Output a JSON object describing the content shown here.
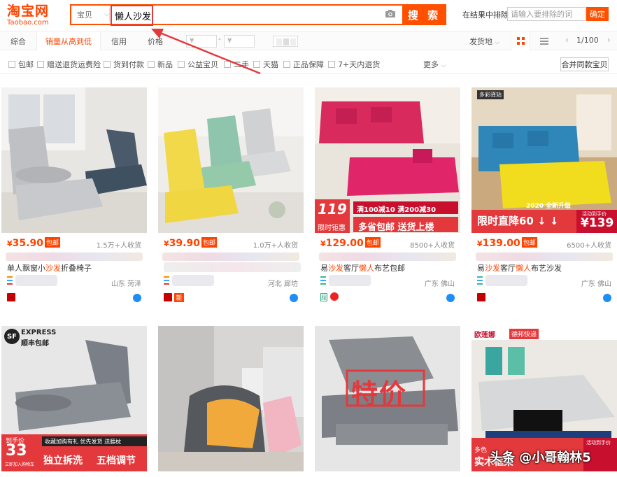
{
  "header": {
    "logo_cn": "淘宝网",
    "logo_en": "Taobao.com",
    "search_scope": "宝贝",
    "search_query": "懒人沙发",
    "search_button": "搜 索",
    "exclude_label": "在结果中排除",
    "exclude_placeholder": "请输入要排除的词",
    "exclude_button": "确定"
  },
  "sortbar": {
    "tabs": [
      "综合",
      "销量从高到低",
      "信用",
      "价格"
    ],
    "active_tab": "销量从高到低",
    "price_from": "¥",
    "price_to": "¥",
    "price_dash": "-",
    "origin": "发货地",
    "pager": "1/100"
  },
  "filters": {
    "items": [
      "包邮",
      "赠送退货运费险",
      "货到付款",
      "新品",
      "公益宝贝",
      "二手",
      "天猫",
      "正品保障",
      "7+天内退货"
    ],
    "more": "更多",
    "merge": "合并同款宝贝"
  },
  "products": [
    {
      "yen": "¥",
      "price": "35.90",
      "baoyou": "包邮",
      "sales": "1.5万+人收货",
      "title_pre": "单人飘窗小",
      "title_hl": "沙发",
      "title_post": "折叠椅子",
      "location": "山东 菏泽"
    },
    {
      "yen": "¥",
      "price": "39.90",
      "baoyou": "包邮",
      "sales": "1.0万+人收货",
      "location": "河北 廊坊"
    },
    {
      "yen": "¥",
      "price": "129.00",
      "baoyou": "包邮",
      "sales": "8500+人收货",
      "title_pre": "易",
      "title_hl": "沙发",
      "title_mid": "客厅",
      "title_hl2": "懒人",
      "title_post": "布艺包邮",
      "location": "广东 佛山",
      "img_price": "119",
      "img_promo1": "满100减10 满200减30",
      "img_limited": "限时钜惠",
      "img_promo2": "多省包邮 送货上楼"
    },
    {
      "yen": "¥",
      "price": "139.00",
      "baoyou": "包邮",
      "sales": "6500+人收货",
      "title_pre": "易",
      "title_hl": "沙发",
      "title_mid": "客厅",
      "title_hl2": "懒人",
      "title_post": "布艺沙发",
      "location": "广东 佛山",
      "img_top": "多彩驿站",
      "img_upgrade": "2020 全新升级",
      "img_flash": "限时直降60 ↓ ↓",
      "img_price": "¥139",
      "img_note": "活动到手价"
    }
  ],
  "row2": [
    {
      "express": "EXPRESS",
      "sf": "顺丰包邮",
      "sf_logo": "SF",
      "price_tag": "到手价",
      "price_big": "33",
      "price_note": "立即加入购物车",
      "promo_top": "收藏加购有礼 优先发货 送腰枕",
      "promo_a": "独立拆洗",
      "promo_b": "五档调节"
    },
    {},
    {
      "tejia": "特价"
    },
    {
      "brand": "欧莲娜",
      "courier": "德邦快递",
      "note": "活动到手价",
      "bottom": "多色",
      "bottom2": "实木框架"
    }
  ],
  "watermark": "头条 @小哥翰林5",
  "colors": {
    "accent": "#ff5000",
    "price": "#f40",
    "highlight_box": "#e4393c"
  }
}
